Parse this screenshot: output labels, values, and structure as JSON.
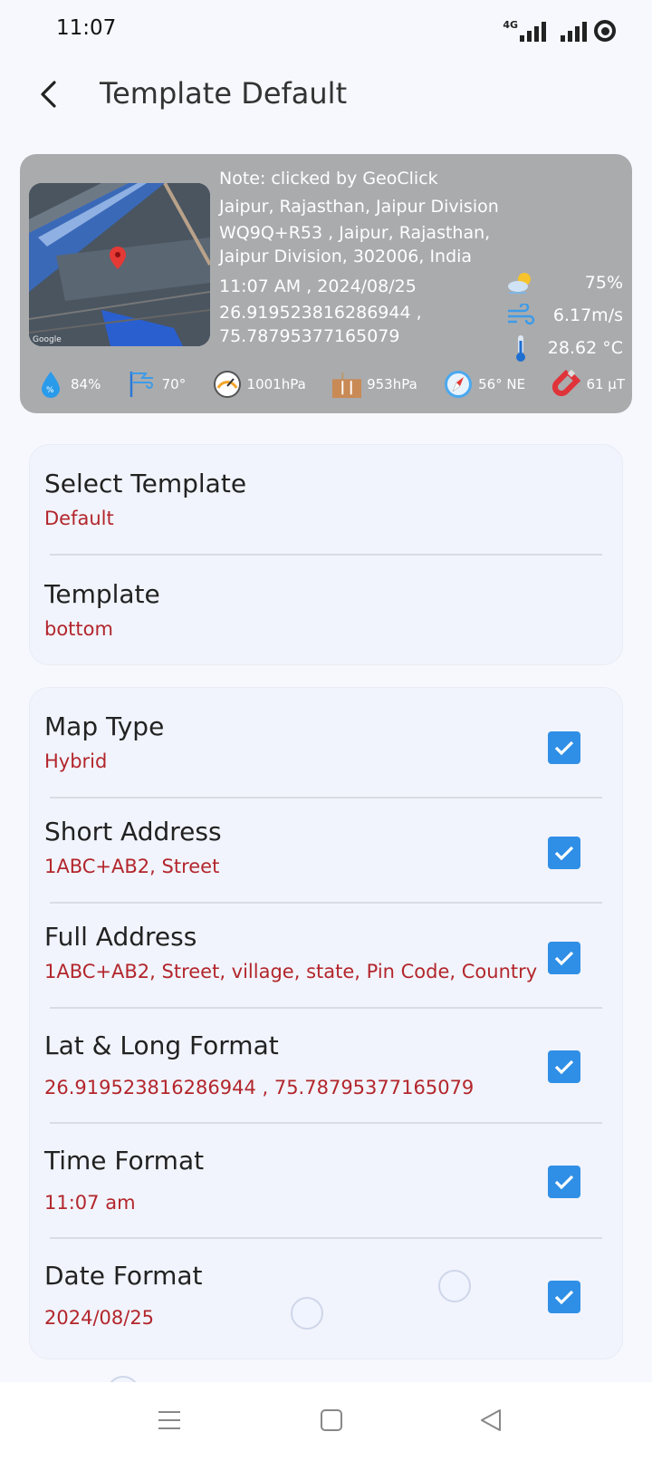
{
  "status": {
    "time": "11:07",
    "network": "4G"
  },
  "header": {
    "title": "Template Default"
  },
  "preview": {
    "note": "Note: clicked by GeoClick",
    "short_address": "Jaipur, Rajasthan, Jaipur Division",
    "full_address_line1": "WQ9Q+R53  , Jaipur, Rajasthan,",
    "full_address_line2": "Jaipur Division, 302006, India",
    "datetime": "11:07 AM , 2024/08/25",
    "lat": "26.919523816286944 ,",
    "lng": "75.78795377165079",
    "map_attribution": "Google",
    "weather": {
      "cloud": "75%",
      "wind_speed": "6.17m/s",
      "temperature": "28.62 °C"
    },
    "sensors": {
      "humidity": "84%",
      "wind_dir": "70°",
      "pressure": "1001hPa",
      "altitude_pressure": "953hPa",
      "compass": "56° NE",
      "magnetic": "61 μT"
    }
  },
  "template_card": {
    "select_template_title": "Select Template",
    "select_template_value": "Default",
    "template_title": "Template",
    "template_value": "bottom"
  },
  "options": [
    {
      "title": "Map Type",
      "value": "Hybrid",
      "checked": true
    },
    {
      "title": "Short Address",
      "value": "1ABC+AB2, Street",
      "checked": true
    },
    {
      "title": "Full Address",
      "value": "1ABC+AB2, Street, village, state, Pin Code, Country",
      "checked": true
    },
    {
      "title": "Lat & Long Format",
      "value": "26.919523816286944 , 75.78795377165079",
      "checked": true
    },
    {
      "title": "Time Format",
      "value": "11:07 am",
      "checked": true
    },
    {
      "title": "Date Format",
      "value": "2024/08/25",
      "checked": true
    }
  ],
  "colors": {
    "accent": "#2f8fe6",
    "value_red": "#b3262c",
    "card_bg": "#aaabad"
  }
}
